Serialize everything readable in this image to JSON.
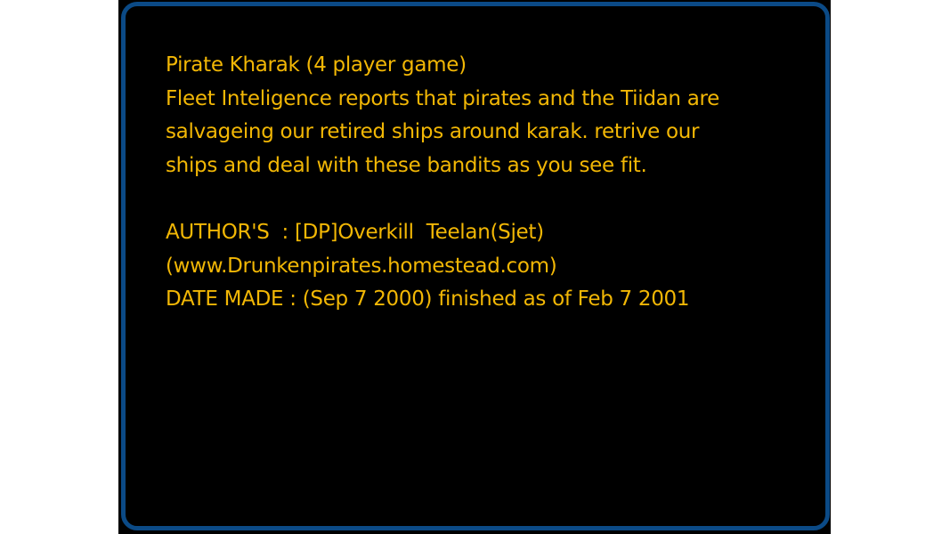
{
  "briefing": {
    "lines": [
      "Pirate Kharak (4 player game)",
      "Fleet Inteligence reports that pirates and the Tiidan are",
      "salvageing our retired ships around karak. retrive our",
      "ships and deal with these bandits as you see fit.",
      "",
      "AUTHOR'S  : [DP]Overkill  Teelan(Sjet)",
      "(www.Drunkenpirates.homestead.com)",
      "DATE MADE : (Sep 7 2000) finished as of Feb 7 2001"
    ]
  },
  "colors": {
    "text": "#f2b705",
    "frame_border": "#0b4a86",
    "panel_background": "#000000",
    "page_background": "#ffffff"
  }
}
